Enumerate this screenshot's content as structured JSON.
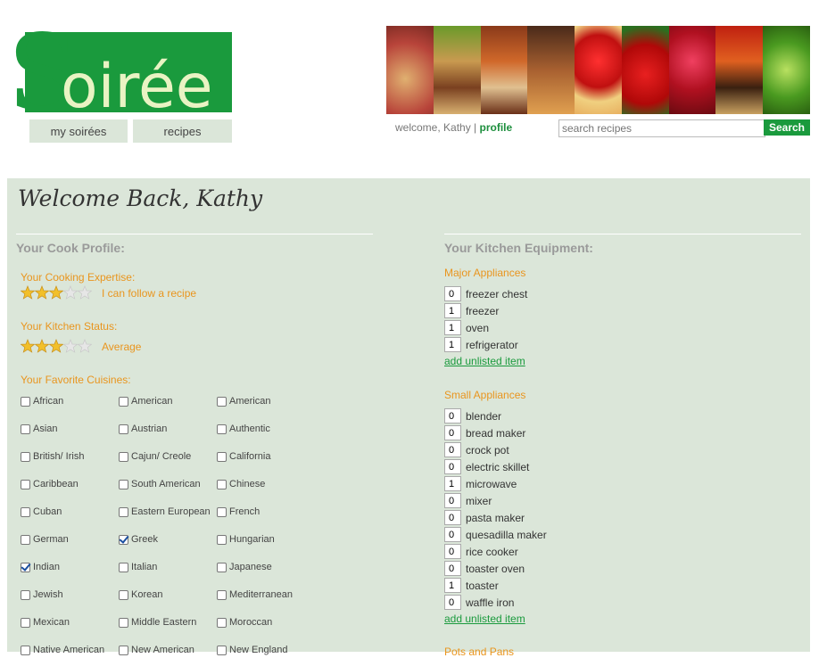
{
  "logo": {
    "text": "Soirée"
  },
  "nav": {
    "my_soirees": "my soirées",
    "recipes": "recipes"
  },
  "header": {
    "welcome": "welcome, Kathy",
    "separator": "|",
    "profile": "profile",
    "search_placeholder": "search recipes",
    "search_button": "Search"
  },
  "main": {
    "title": "Welcome Back, Kathy",
    "cook_profile": {
      "heading": "Your Cook Profile:",
      "expertise_label": "Your Cooking Expertise:",
      "expertise_rating": 3,
      "expertise_text": "I can follow a recipe",
      "kitchen_label": "Your Kitchen Status:",
      "kitchen_rating": 3,
      "kitchen_text": "Average",
      "cuisines_label": "Your Favorite Cuisines:",
      "cuisines": [
        {
          "name": "African",
          "checked": false
        },
        {
          "name": "American",
          "checked": false
        },
        {
          "name": "American",
          "checked": false
        },
        {
          "name": "Asian",
          "checked": false
        },
        {
          "name": "Austrian",
          "checked": false
        },
        {
          "name": "Authentic",
          "checked": false
        },
        {
          "name": "British/ Irish",
          "checked": false
        },
        {
          "name": "Cajun/ Creole",
          "checked": false
        },
        {
          "name": "California",
          "checked": false
        },
        {
          "name": "Caribbean",
          "checked": false
        },
        {
          "name": "South American",
          "checked": false
        },
        {
          "name": "Chinese",
          "checked": false
        },
        {
          "name": "Cuban",
          "checked": false
        },
        {
          "name": "Eastern European",
          "checked": false
        },
        {
          "name": "French",
          "checked": false
        },
        {
          "name": "German",
          "checked": false
        },
        {
          "name": "Greek",
          "checked": true
        },
        {
          "name": "Hungarian",
          "checked": false
        },
        {
          "name": "Indian",
          "checked": true
        },
        {
          "name": "Italian",
          "checked": false
        },
        {
          "name": "Japanese",
          "checked": false
        },
        {
          "name": "Jewish",
          "checked": false
        },
        {
          "name": "Korean",
          "checked": false
        },
        {
          "name": "Mediterranean",
          "checked": false
        },
        {
          "name": "Mexican",
          "checked": false
        },
        {
          "name": "Middle Eastern",
          "checked": false
        },
        {
          "name": "Moroccan",
          "checked": false
        },
        {
          "name": "Native American",
          "checked": false
        },
        {
          "name": "New American",
          "checked": false
        },
        {
          "name": "New England",
          "checked": false
        }
      ]
    },
    "equipment": {
      "heading": "Your Kitchen Equipment:",
      "major_label": "Major Appliances",
      "major": [
        {
          "qty": "0",
          "name": "freezer chest"
        },
        {
          "qty": "1",
          "name": "freezer"
        },
        {
          "qty": "1",
          "name": "oven"
        },
        {
          "qty": "1",
          "name": "refrigerator"
        }
      ],
      "add_unlisted": "add unlisted item",
      "small_label": "Small Appliances",
      "small": [
        {
          "qty": "0",
          "name": "blender"
        },
        {
          "qty": "0",
          "name": "bread maker"
        },
        {
          "qty": "0",
          "name": "crock pot"
        },
        {
          "qty": "0",
          "name": "electric skillet"
        },
        {
          "qty": "1",
          "name": "microwave"
        },
        {
          "qty": "0",
          "name": "mixer"
        },
        {
          "qty": "0",
          "name": "pasta maker"
        },
        {
          "qty": "0",
          "name": "quesadilla maker"
        },
        {
          "qty": "0",
          "name": "rice cooker"
        },
        {
          "qty": "0",
          "name": "toaster oven"
        },
        {
          "qty": "1",
          "name": "toaster"
        },
        {
          "qty": "0",
          "name": "waffle iron"
        }
      ],
      "pots_label": "Pots and Pans"
    }
  },
  "colors": {
    "brand_green": "#1a9a3d",
    "panel_bg": "#dbe6d9",
    "accent_orange": "#e9951e"
  }
}
